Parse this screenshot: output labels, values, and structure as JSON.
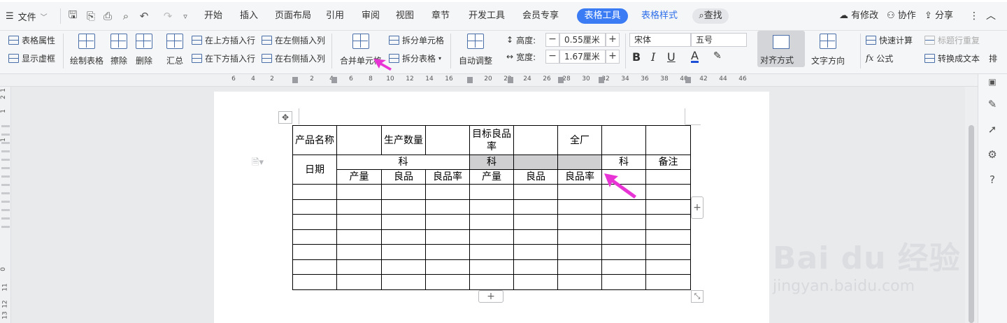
{
  "menubar": {
    "file": "文件",
    "tabs": [
      "开始",
      "插入",
      "页面布局",
      "引用",
      "审阅",
      "视图",
      "章节",
      "开发工具",
      "会员专享"
    ],
    "active_tab": "表格工具",
    "extra_tab": "表格样式",
    "search": "查找",
    "right": {
      "modified": "有修改",
      "collab": "协作",
      "share": "分享"
    }
  },
  "ribbon": {
    "table_props": "表格属性",
    "show_gridlines": "显示虚框",
    "draw_table": "绘制表格",
    "erase": "擦除",
    "delete": "删除",
    "summary": "汇总",
    "insert_row_above": "在上方插入行",
    "insert_row_below": "在下方插入行",
    "insert_col_left": "在左侧插入列",
    "insert_col_right": "在右侧插入列",
    "merge_cells": "合并单元格",
    "split_cells": "拆分单元格",
    "split_table": "拆分表格",
    "auto_fit": "自动调整",
    "height_label": "高度:",
    "height_value": "0.55厘米",
    "width_label": "宽度:",
    "width_value": "1.67厘米",
    "font_name": "宋体",
    "font_size": "五号",
    "bold": "B",
    "italic": "I",
    "underline": "U",
    "font_color": "A",
    "alignment": "对齐方式",
    "text_direction": "文字方向",
    "quick_calc": "快速计算",
    "formula": "公式",
    "repeat_header": "标题行重复",
    "convert_text": "转换成文本",
    "sort": "排"
  },
  "ruler": {
    "ticks": [
      "6",
      "4",
      "2",
      "2",
      "4",
      "6",
      "8",
      "10",
      "12",
      "14",
      "16",
      "20",
      "22",
      "24",
      "26",
      "28",
      "30",
      "32",
      "34",
      "36",
      "38",
      "40",
      "42",
      "44",
      "46"
    ],
    "v_ticks": [
      "1",
      "2",
      "1",
      "1",
      "0",
      "11",
      "12",
      "13"
    ]
  },
  "table": {
    "rows": [
      [
        "产品名称",
        "",
        "生产数量",
        "",
        "目标良品率",
        "",
        "全厂",
        "",
        ""
      ],
      [
        "日期",
        "科",
        "科",
        "科",
        "备注"
      ],
      [
        "产量",
        "良品",
        "良品率",
        "产量",
        "良品",
        "良品率"
      ]
    ],
    "empty_rows": 7,
    "columns": 9
  },
  "watermark": {
    "brand": "Bai du 经验",
    "url": "jingyan.baidu.com"
  },
  "colors": {
    "accent": "#3b7cf5",
    "arrow": "#e834d5",
    "selected_cell": "#cfcfd1"
  }
}
